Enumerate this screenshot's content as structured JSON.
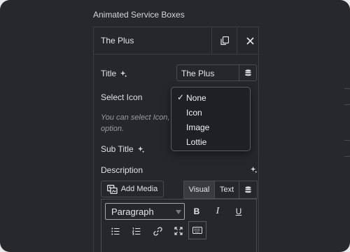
{
  "widget": {
    "title": "Animated Service Boxes"
  },
  "panel": {
    "title": "The Plus",
    "title_field": {
      "label": "Title",
      "value": "The Plus"
    },
    "select_icon": {
      "label": "Select Icon",
      "help": "You can select Icon, C option."
    },
    "subtitle": {
      "label": "Sub Title"
    },
    "description": {
      "label": "Description"
    },
    "add_media": "Add Media",
    "tabs": {
      "visual": "Visual",
      "text": "Text"
    },
    "format": "Paragraph",
    "tools": {
      "bold": "B",
      "italic": "I",
      "underline": "U"
    }
  },
  "dropdown": {
    "selected": "None",
    "options": [
      "None",
      "Icon",
      "Image",
      "Lottie"
    ]
  }
}
